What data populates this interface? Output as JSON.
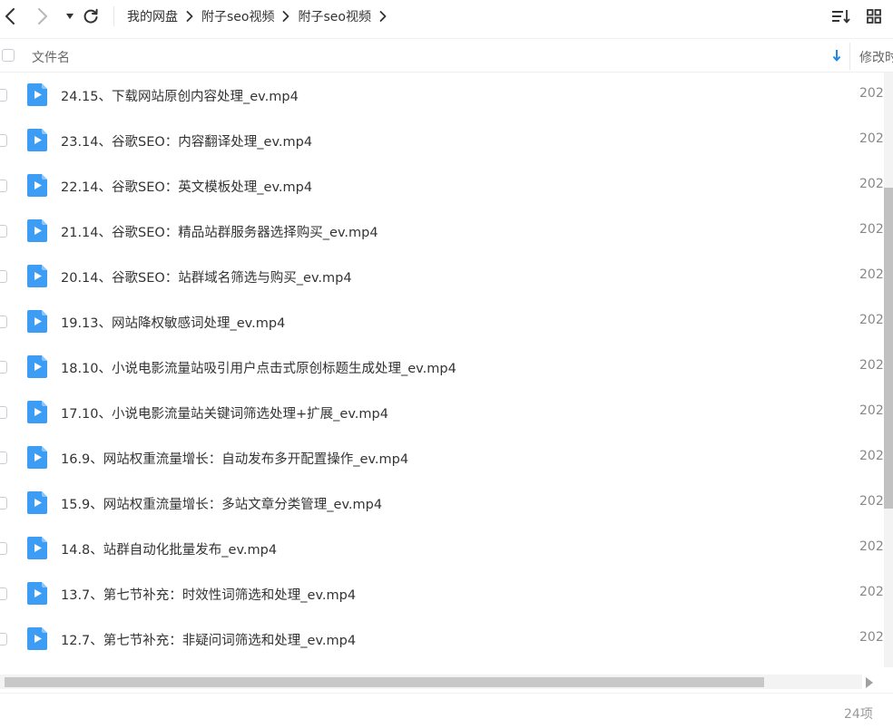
{
  "toolbar": {
    "icons": {
      "back": "chevron-left-icon",
      "forward": "chevron-right-icon",
      "history_dropdown": "caret-down-icon",
      "refresh": "refresh-icon",
      "sort_list": "sort-list-icon",
      "grid_view": "grid-view-icon"
    }
  },
  "breadcrumb": [
    "我的网盘",
    "附子seo视频",
    "附子seo视频"
  ],
  "list_header": {
    "name_label": "文件名",
    "modified_label": "修改时",
    "sort_direction": "descending"
  },
  "files": [
    {
      "name": "24.15、下载网站原创内容处理_ev.mp4",
      "modified": "202"
    },
    {
      "name": "23.14、谷歌SEO：内容翻译处理_ev.mp4",
      "modified": "202"
    },
    {
      "name": "22.14、谷歌SEO：英文模板处理_ev.mp4",
      "modified": "202"
    },
    {
      "name": "21.14、谷歌SEO：精品站群服务器选择购买_ev.mp4",
      "modified": "202"
    },
    {
      "name": "20.14、谷歌SEO：站群域名筛选与购买_ev.mp4",
      "modified": "202"
    },
    {
      "name": "19.13、网站降权敏感词处理_ev.mp4",
      "modified": "202"
    },
    {
      "name": "18.10、小说电影流量站吸引用户点击式原创标题生成处理_ev.mp4",
      "modified": "202"
    },
    {
      "name": "17.10、小说电影流量站关键词筛选处理+扩展_ev.mp4",
      "modified": "202"
    },
    {
      "name": "16.9、网站权重流量增长：自动发布多开配置操作_ev.mp4",
      "modified": "202"
    },
    {
      "name": "15.9、网站权重流量增长：多站文章分类管理_ev.mp4",
      "modified": "202"
    },
    {
      "name": "14.8、站群自动化批量发布_ev.mp4",
      "modified": "202"
    },
    {
      "name": "13.7、第七节补充：时效性词筛选和处理_ev.mp4",
      "modified": "202"
    },
    {
      "name": "12.7、第七节补充：非疑问词筛选和处理_ev.mp4",
      "modified": "202"
    }
  ],
  "file_icon": "video-file-icon",
  "scrollbars": {
    "vertical_position": 0.42,
    "vertical_visible_fraction": 0.54,
    "horizontal_position": 0,
    "horizontal_visible_fraction": 0.89
  },
  "footer": {
    "item_count": "24项"
  },
  "colors": {
    "accent": "#1e88e5",
    "file_icon": "#3d9df5",
    "text": "#333333"
  }
}
